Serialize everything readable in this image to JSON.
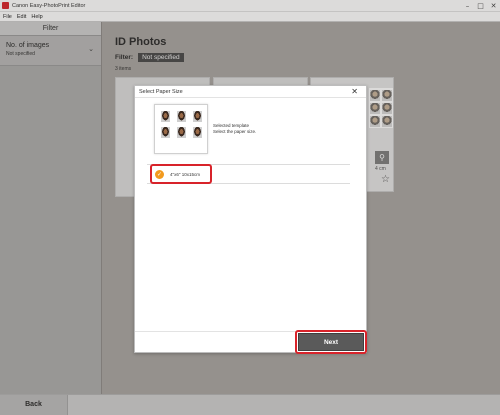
{
  "window": {
    "title": "Canon Easy-PhotoPrint Editor",
    "controls": {
      "minimize": "–",
      "maximize": "□",
      "close": "✕"
    }
  },
  "menu": {
    "items": [
      "File",
      "Edit",
      "Help"
    ]
  },
  "sidebar": {
    "header": "Filter",
    "filters": [
      {
        "label": "No. of images",
        "value": "Not specified",
        "icon": "chevron-down-icon"
      }
    ]
  },
  "main": {
    "title": "ID Photos",
    "filter_label": "Filter:",
    "filter_value": "Not specified",
    "item_count": "3 items",
    "card3": {
      "size_label": "4 cm",
      "icons": [
        "search-icon",
        "star-icon"
      ]
    }
  },
  "dialog": {
    "title": "Select Paper Size",
    "close": "✕",
    "selected_template_label": "Selected template",
    "instruction": "Select the paper size.",
    "options": [
      {
        "label": "4\"x6\" 10x15cm",
        "selected": true
      }
    ],
    "next_button": "Next"
  },
  "footer": {
    "back_button": "Back"
  },
  "colors": {
    "accent_orange": "#f29a1e",
    "highlight_red": "#d8232a",
    "next_button_bg": "#5a5a5a"
  }
}
